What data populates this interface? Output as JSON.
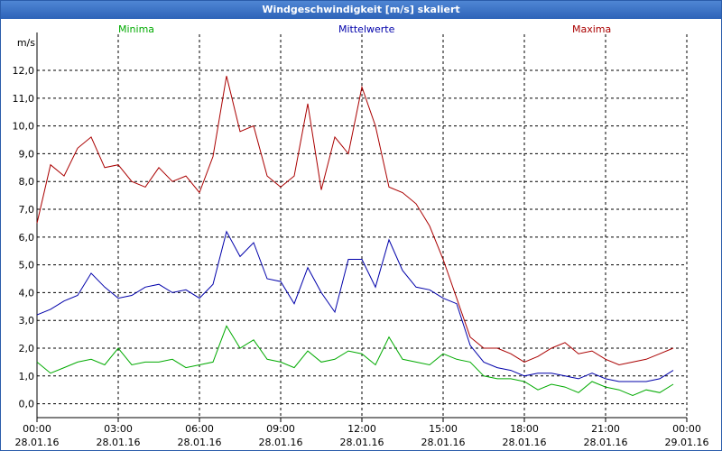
{
  "window": {
    "title": "Windgeschwindigkeit [m/s] skaliert"
  },
  "chart_data": {
    "type": "line",
    "ylabel": "m/s",
    "ylim": [
      -0.5,
      13.3
    ],
    "xlim": [
      0,
      24
    ],
    "yticks": [
      "0,0",
      "1,0",
      "2,0",
      "3,0",
      "4,0",
      "5,0",
      "6,0",
      "7,0",
      "8,0",
      "9,0",
      "10,0",
      "11,0",
      "12,0"
    ],
    "xticks": [
      {
        "time": "00:00",
        "date": "28.01.16"
      },
      {
        "time": "03:00",
        "date": "28.01.16"
      },
      {
        "time": "06:00",
        "date": "28.01.16"
      },
      {
        "time": "09:00",
        "date": "28.01.16"
      },
      {
        "time": "12:00",
        "date": "28.01.16"
      },
      {
        "time": "15:00",
        "date": "28.01.16"
      },
      {
        "time": "18:00",
        "date": "28.01.16"
      },
      {
        "time": "21:00",
        "date": "28.01.16"
      },
      {
        "time": "00:00",
        "date": "29.01.16"
      }
    ],
    "grid": true,
    "x": [
      0,
      0.5,
      1,
      1.5,
      2,
      2.5,
      3,
      3.5,
      4,
      4.5,
      5,
      5.5,
      6,
      6.5,
      7,
      7.5,
      8,
      8.5,
      9,
      9.5,
      10,
      10.5,
      11,
      11.5,
      12,
      12.5,
      13,
      13.5,
      14,
      14.5,
      15,
      15.5,
      16,
      16.5,
      17,
      17.5,
      18,
      18.5,
      19,
      19.5,
      20,
      20.5,
      21,
      21.5,
      22,
      22.5,
      23,
      23.5
    ],
    "series": [
      {
        "name": "Minima",
        "color": "#00aa00",
        "values": [
          1.5,
          1.1,
          1.3,
          1.5,
          1.6,
          1.4,
          2.0,
          1.4,
          1.5,
          1.5,
          1.6,
          1.3,
          1.4,
          1.5,
          2.8,
          2.0,
          2.3,
          1.6,
          1.5,
          1.3,
          1.9,
          1.5,
          1.6,
          1.9,
          1.8,
          1.4,
          2.4,
          1.6,
          1.5,
          1.4,
          1.8,
          1.6,
          1.5,
          1.0,
          0.9,
          0.9,
          0.8,
          0.5,
          0.7,
          0.6,
          0.4,
          0.8,
          0.6,
          0.5,
          0.3,
          0.5,
          0.4,
          0.7
        ]
      },
      {
        "name": "Mittelwerte",
        "color": "#0000aa",
        "values": [
          3.2,
          3.4,
          3.7,
          3.9,
          4.7,
          4.2,
          3.8,
          3.9,
          4.2,
          4.3,
          4.0,
          4.1,
          3.8,
          4.3,
          6.2,
          5.3,
          5.8,
          4.5,
          4.4,
          3.6,
          4.9,
          4.0,
          3.3,
          5.2,
          5.2,
          4.2,
          5.9,
          4.8,
          4.2,
          4.1,
          3.8,
          3.6,
          2.1,
          1.5,
          1.3,
          1.2,
          1.0,
          1.1,
          1.1,
          1.0,
          0.9,
          1.1,
          0.9,
          0.8,
          0.8,
          0.8,
          0.9,
          1.2
        ]
      },
      {
        "name": "Maxima",
        "color": "#aa0000",
        "values": [
          6.5,
          8.6,
          8.2,
          9.2,
          9.6,
          8.5,
          8.6,
          8.0,
          7.8,
          8.5,
          8.0,
          8.2,
          7.6,
          8.9,
          11.8,
          9.8,
          10.0,
          8.2,
          7.8,
          8.2,
          10.8,
          7.7,
          9.6,
          9.0,
          11.4,
          10.0,
          7.8,
          7.6,
          7.2,
          6.4,
          5.2,
          3.8,
          2.4,
          2.0,
          2.0,
          1.8,
          1.5,
          1.7,
          2.0,
          2.2,
          1.8,
          1.9,
          1.6,
          1.4,
          1.5,
          1.6,
          1.8,
          2.0
        ]
      }
    ]
  }
}
